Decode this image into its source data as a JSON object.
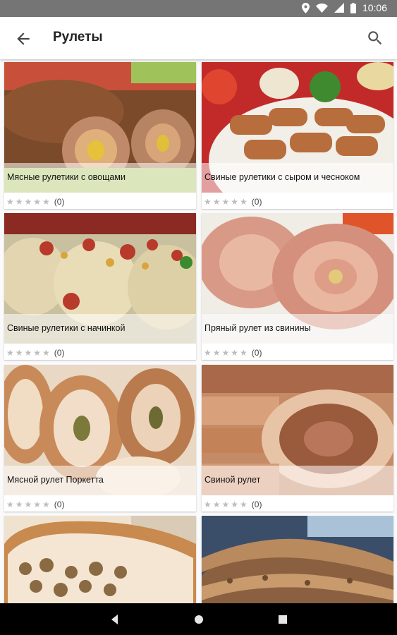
{
  "status": {
    "time": "10:06",
    "icons": [
      "location-icon",
      "wifi-icon",
      "signal-icon",
      "battery-icon"
    ]
  },
  "appbar": {
    "title": "Рулеты",
    "back_icon": "arrow-back-icon",
    "search_icon": "search-icon"
  },
  "recipes": [
    {
      "title": "Мясные рулетики с овощами",
      "rating": 0,
      "count": "(0)"
    },
    {
      "title": "Свиные рулетики с сыром и чесноком",
      "rating": 0,
      "count": "(0)"
    },
    {
      "title": "Свиные рулетики с начинкой",
      "rating": 0,
      "count": "(0)"
    },
    {
      "title": "Пряный рулет из свинины",
      "rating": 0,
      "count": "(0)"
    },
    {
      "title": "Мясной рулет Поркетта",
      "rating": 0,
      "count": "(0)"
    },
    {
      "title": "Свиной рулет",
      "rating": 0,
      "count": "(0)"
    },
    {
      "title": "",
      "rating": 0,
      "count": ""
    },
    {
      "title": "",
      "rating": 0,
      "count": ""
    }
  ],
  "navbar": {
    "icons": [
      "nav-back-icon",
      "nav-home-icon",
      "nav-recents-icon"
    ]
  }
}
